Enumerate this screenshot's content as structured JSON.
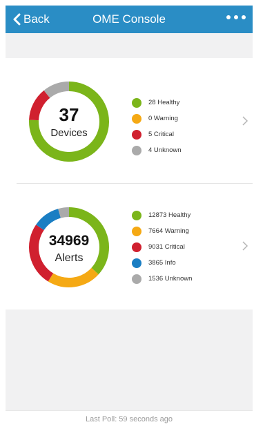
{
  "nav": {
    "back_label": "Back",
    "title": "OME Console",
    "more_icon": "more-horizontal-icon"
  },
  "colors": {
    "nav_bg": "#2a8dc5",
    "healthy": "#7bb51a",
    "warning": "#f5a914",
    "critical": "#d0202f",
    "info": "#1a7ec3",
    "unknown": "#aaaaaa"
  },
  "devices": {
    "total": "37",
    "label": "Devices",
    "legend": [
      {
        "label": "28 Healthy",
        "value": 28,
        "color": "#7bb51a"
      },
      {
        "label": "0 Warning",
        "value": 0,
        "color": "#f5a914"
      },
      {
        "label": "5 Critical",
        "value": 5,
        "color": "#d0202f"
      },
      {
        "label": "4 Unknown",
        "value": 4,
        "color": "#aaaaaa"
      }
    ]
  },
  "alerts": {
    "total": "34969",
    "label": "Alerts",
    "legend": [
      {
        "label": "12873 Healthy",
        "value": 12873,
        "color": "#7bb51a"
      },
      {
        "label": "7664 Warning",
        "value": 7664,
        "color": "#f5a914"
      },
      {
        "label": "9031 Critical",
        "value": 9031,
        "color": "#d0202f"
      },
      {
        "label": "3865 Info",
        "value": 3865,
        "color": "#1a7ec3"
      },
      {
        "label": "1536 Unknown",
        "value": 1536,
        "color": "#aaaaaa"
      }
    ]
  },
  "footer": {
    "last_poll": "Last Poll: 59 seconds ago"
  }
}
